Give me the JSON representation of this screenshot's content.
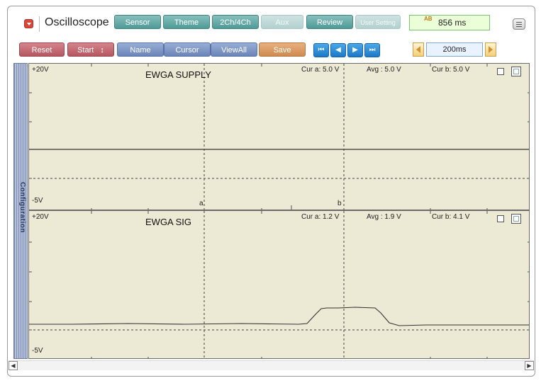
{
  "app": {
    "title": "Oscilloscope"
  },
  "toolbar": {
    "top_buttons": [
      "Sensor",
      "Theme",
      "2Ch/4Ch",
      "Aux",
      "Review",
      "User Setting"
    ],
    "time_readout": {
      "badge": "AB",
      "value": "856 ms"
    },
    "action_buttons": {
      "reset": "Reset",
      "start": "Start",
      "start_arrow": "↕",
      "name": "Name",
      "cursor": "Cursor",
      "viewall": "ViewAll",
      "save": "Save"
    },
    "nav": {
      "first": "⏮",
      "prev": "◀",
      "next": "▶",
      "last": "⏭"
    },
    "zoom": {
      "value": "200ms"
    }
  },
  "sidebar": {
    "label": "Configuration"
  },
  "channels": [
    {
      "title": "EWGA SUPPLY",
      "ymax_label": "+20V",
      "ymin_label": "-5V",
      "cur_a": "Cur a: 5.0 V",
      "avg": "Avg : 5.0 V",
      "cur_b": "Cur b: 5.0 V",
      "cursor_a_label": "a",
      "cursor_b_label": "b"
    },
    {
      "title": "EWGA SIG",
      "ymax_label": "+20V",
      "ymin_label": "-5V",
      "cur_a": "Cur a: 1.2 V",
      "avg": "Avg : 1.9 V",
      "cur_b": "Cur b: 4.1 V"
    }
  ],
  "colors": {
    "plot_bg": "#ece9d5",
    "trace": "#333333",
    "grid_dash": "#444444",
    "accent_teal": "#4f9a96"
  }
}
